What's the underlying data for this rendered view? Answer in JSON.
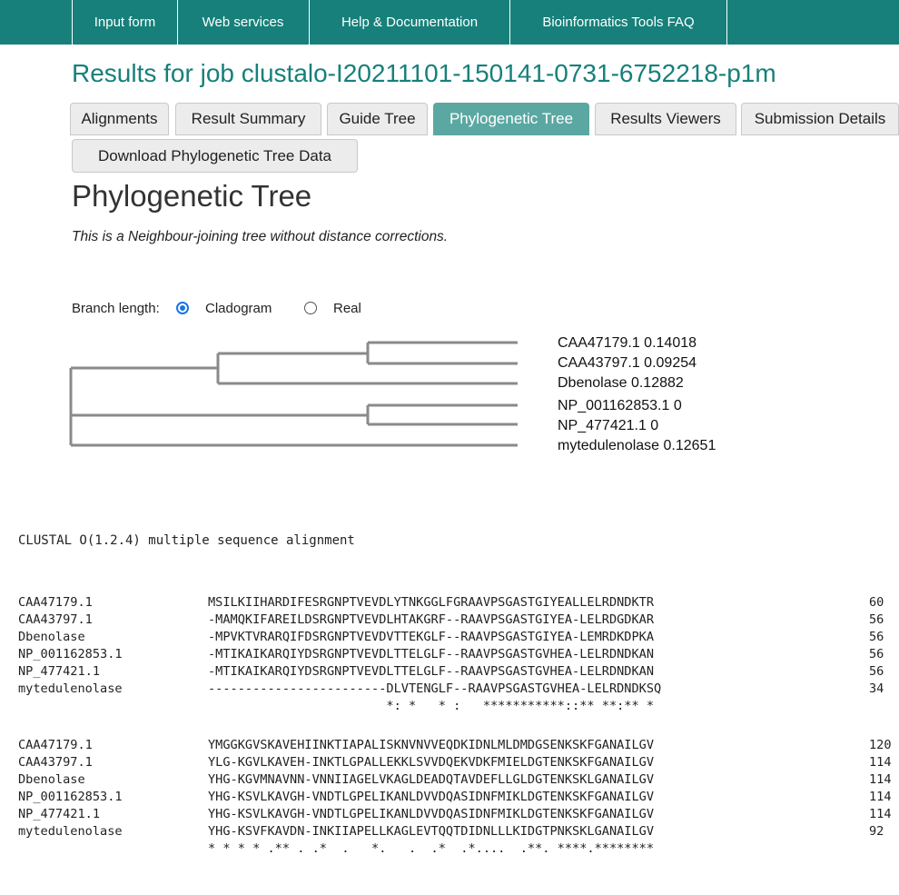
{
  "nav": [
    "Input form",
    "Web services",
    "Help & Documentation",
    "Bioinformatics Tools FAQ"
  ],
  "page_title": "Results for job clustalo-I20211101-150141-0731-6752218-p1m",
  "tabs": [
    "Alignments",
    "Result Summary",
    "Guide Tree",
    "Phylogenetic Tree",
    "Results Viewers",
    "Submission Details"
  ],
  "active_tab": "Phylogenetic Tree",
  "download_label": "Download Phylogenetic Tree Data",
  "section_title": "Phylogenetic Tree",
  "description": "This is a Neighbour-joining tree without distance corrections.",
  "branch_length": {
    "label": "Branch length:",
    "options": [
      "Cladogram",
      "Real"
    ],
    "selected": "Cladogram"
  },
  "tree": {
    "leaves": [
      "CAA47179.1 0.14018",
      "CAA43797.1 0.09254",
      "Dbenolase 0.12882",
      "NP_001162853.1 0",
      "NP_477421.1 0",
      "mytedulenolase 0.12651"
    ]
  },
  "alignment": {
    "header": "CLUSTAL O(1.2.4) multiple sequence alignment",
    "blocks": [
      {
        "rows": [
          {
            "name": "CAA47179.1",
            "seq": "MSILKIIHARDIFESRGNPTVEVDLYTNKGGLFGRAAVPSGASTGIYEALLELRDNDKTR",
            "pos": "60"
          },
          {
            "name": "CAA43797.1",
            "seq": "-MAMQKIFAREILDSRGNPTVEVDLHTAKGRF--RAAVPSGASTGIYEA-LELRDGDKAR",
            "pos": "56"
          },
          {
            "name": "Dbenolase",
            "seq": "-MPVKTVRARQIFDSRGNPTVEVDVTTEKGLF--RAAVPSGASTGIYEA-LEMRDKDPKA",
            "pos": "56"
          },
          {
            "name": "NP_001162853.1",
            "seq": "-MTIKAIKARQIYDSRGNPTVEVDLTTELGLF--RAAVPSGASTGVHEA-LELRDNDKAN",
            "pos": "56"
          },
          {
            "name": "NP_477421.1",
            "seq": "-MTIKAIKARQIYDSRGNPTVEVDLTTELGLF--RAAVPSGASTGVHEA-LELRDNDKAN",
            "pos": "56"
          },
          {
            "name": "mytedulenolase",
            "seq": "------------------------DLVTENGLF--RAAVPSGASTGVHEA-LELRDNDKSQ",
            "pos": "34"
          }
        ],
        "consensus": "                        *: *   * :   ***********::** **:** *"
      },
      {
        "rows": [
          {
            "name": "CAA47179.1",
            "seq": "YMGGKGVSKAVEHIINKTIAPALISKNVNVVEQDKIDNLMLDMDGSENKSKFGANAILGV",
            "pos": "120"
          },
          {
            "name": "CAA43797.1",
            "seq": "YLG-KGVLKAVEH-INKTLGPALLEKKLSVVDQEKVDKFMIELDGTENKSKFGANAILGV",
            "pos": "114"
          },
          {
            "name": "Dbenolase",
            "seq": "YHG-KGVMNAVNN-VNNIIAGELVKAGLDEADQTAVDEFLLGLDGTENKSKLGANAILGV",
            "pos": "114"
          },
          {
            "name": "NP_001162853.1",
            "seq": "YHG-KSVLKAVGH-VNDTLGPELIKANLDVVDQASIDNFMIKLDGTENKSKFGANAILGV",
            "pos": "114"
          },
          {
            "name": "NP_477421.1",
            "seq": "YHG-KSVLKAVGH-VNDTLGPELIKANLDVVDQASIDNFMIKLDGTENKSKFGANAILGV",
            "pos": "114"
          },
          {
            "name": "mytedulenolase",
            "seq": "YHG-KSVFKAVDN-INKIIAPELLKAGLEVTQQTDIDNLLLKIDGTPNKSKLGANAILGV",
            "pos": "92"
          }
        ],
        "consensus": "* * * * .** . .*  .   *.   .  .*  .*....  .**. ****.********"
      }
    ]
  }
}
